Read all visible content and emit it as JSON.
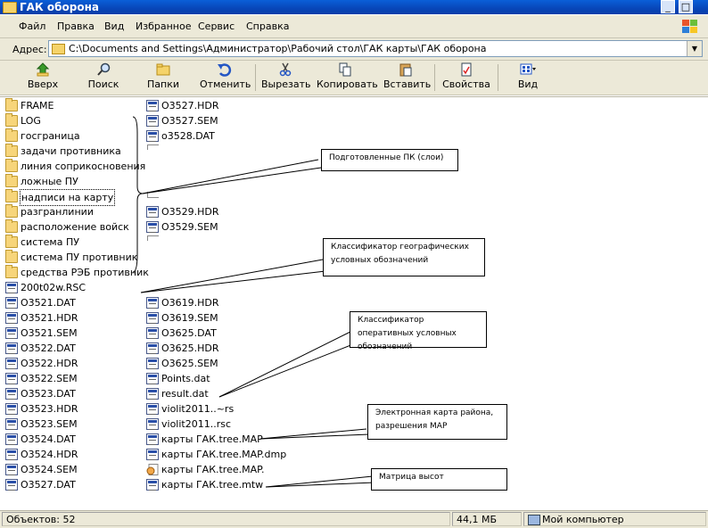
{
  "window": {
    "title": "ГАК оборона",
    "btn_min": "_",
    "btn_max": "□"
  },
  "menu": [
    "Файл",
    "Правка",
    "Вид",
    "Избранное",
    "Сервис",
    "Справка"
  ],
  "address": {
    "label": "Адрес:",
    "value": "C:\\Documents and Settings\\Администратор\\Рабочий стол\\ГАК карты\\ГАК оборона"
  },
  "toolbar": {
    "up": "Вверх",
    "search": "Поиск",
    "folders": "Папки",
    "undo": "Отменить",
    "cut": "Вырезать",
    "copy": "Копировать",
    "paste": "Вставить",
    "props": "Свойства",
    "view": "Вид"
  },
  "folders": [
    "FRAME",
    "LOG",
    "госграница",
    "задачи противника",
    "линия соприкосновения",
    "ложные ПУ",
    "надписи на карту",
    "разгранлинии",
    "расположение войск",
    "система ПУ",
    "система ПУ противник",
    "средства РЭБ противник"
  ],
  "files_col1": [
    "200t02w.RSC",
    "O3521.DAT",
    "O3521.HDR",
    "O3521.SEM",
    "O3522.DAT",
    "O3522.HDR",
    "O3522.SEM",
    "O3523.DAT",
    "O3523.HDR",
    "O3523.SEM",
    "O3524.DAT",
    "O3524.HDR",
    "O3524.SEM",
    "O3527.DAT"
  ],
  "files_col2_top": [
    "O3527.HDR",
    "O3527.SEM",
    "o3528.DAT"
  ],
  "files_col2_mid": [
    "O3529.HDR",
    "O3529.SEM"
  ],
  "files_col2_bottom": [
    "O3619.HDR",
    "O3619.SEM",
    "O3625.DAT",
    "O3625.HDR",
    "O3625.SEM",
    "Points.dat",
    "result.dat",
    "violit2011..~rs",
    "violit2011..rsc",
    "карты ГАК.tree.MAP",
    "карты ГАК.tree.MAP.dmp",
    "карты ГАК.tree.MAP.",
    "карты ГАК.tree.mtw"
  ],
  "callouts": {
    "layers": "Подготовленные ПК (слои)",
    "geo": "Классификатор географических условных обозначений",
    "oper": "Классификатор оперативных условных обозначений",
    "map": "Электронная карта района, разрешения MAP",
    "matrix": "Матрица высот"
  },
  "status": {
    "objects": "Объектов: 52",
    "size": "44,1 МБ",
    "location": "Мой компьютер"
  }
}
